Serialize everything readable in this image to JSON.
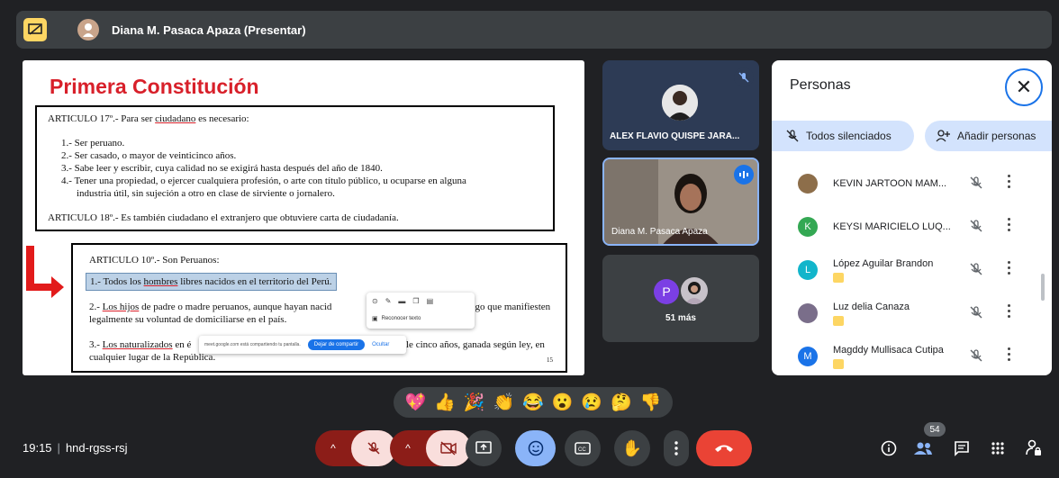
{
  "topbar": {
    "presenter_title": "Diana M. Pasaca Apaza (Presentar)"
  },
  "slide": {
    "heading": "Primera Constitución",
    "box1": {
      "art17_pre": "ARTICULO 17º.- Para ser ",
      "art17_word": "ciudadano",
      "art17_post": " es necesario:",
      "item1": "1.- Ser peruano.",
      "item2": "2.- Ser casado, o mayor de veinticinco años.",
      "item3": "3.- Sabe leer y escribir, cuya calidad no se exigirá hasta después del año de 1840.",
      "item4a": "4.- Tener una propiedad, o ejercer cualquiera profesión, o arte con título público, u ocuparse en alguna",
      "item4b": "industria útil, sin  sujeción a otro en clase de sirviente o jornalero.",
      "art18": "ARTICULO 18º.- Es también ciudadano el extranjero que obtuviere carta de ciudadanía."
    },
    "box2": {
      "art10": "ARTICULO 10º.- Son Peruanos:",
      "p1_pre": "1.- Todos los ",
      "p1_word": "hombres",
      "p1_post": " libres nacidos en el territorio del Perú.",
      "p2_pre": "2.- ",
      "p2_word": "Los hijos",
      "p2_post": " de padre o madre peruanos, aunque hayan nacid",
      "p2_end": "luego que manifiesten",
      "p2_line2": "legalmente su voluntad de domiciliarse en el país.",
      "p3_pre": "3.- ",
      "p3_word": "Los naturalizados",
      "p3_mid": " en é",
      "p3_end": "le cinco años, ganada según ley, en",
      "p3_line2": "cualquier lugar de la República.",
      "page_number": "15"
    },
    "context_menu": {
      "recognize_text": "Reconocer texto"
    },
    "share_bar": {
      "message": "meet.google.com está compartiendo tu pantalla.",
      "stop_label": "Dejar de compartir",
      "hide_label": "Ocultar"
    }
  },
  "tiles": {
    "tile1_name": "ALEX FLAVIO QUISPE JARA...",
    "tile2_name": "Diana M. Pasaca Apaza",
    "tile3_avatar": "P",
    "tile3_more": "51 más"
  },
  "panel": {
    "title": "Personas",
    "mute_all_label": "Todos silenciados",
    "add_people_label": "Añadir personas",
    "participants": [
      {
        "name": "KEVIN JARTOON MAM...",
        "initial": "",
        "color": "#8d6e4a",
        "badge": false
      },
      {
        "name": "KEYSI MARICIELO LUQ...",
        "initial": "K",
        "color": "#34a853",
        "badge": false
      },
      {
        "name": "López Aguilar Brandon",
        "initial": "L",
        "color": "#12b5cb",
        "badge": true
      },
      {
        "name": "Luz delia Canaza",
        "initial": "",
        "color": "#7a6e8a",
        "badge": true
      },
      {
        "name": "Magddy Mullisaca Cutipa",
        "initial": "M",
        "color": "#1a73e8",
        "badge": true
      }
    ]
  },
  "reactions": [
    "💖",
    "👍",
    "🎉",
    "👏",
    "😂",
    "😮",
    "😢",
    "🤔",
    "👎"
  ],
  "bottom": {
    "time": "19:15",
    "meeting_code": "hnd-rgss-rsj",
    "participant_count": "54"
  },
  "colors": {
    "accent": "#1a73e8",
    "danger": "#ea4335",
    "background": "#202124"
  }
}
